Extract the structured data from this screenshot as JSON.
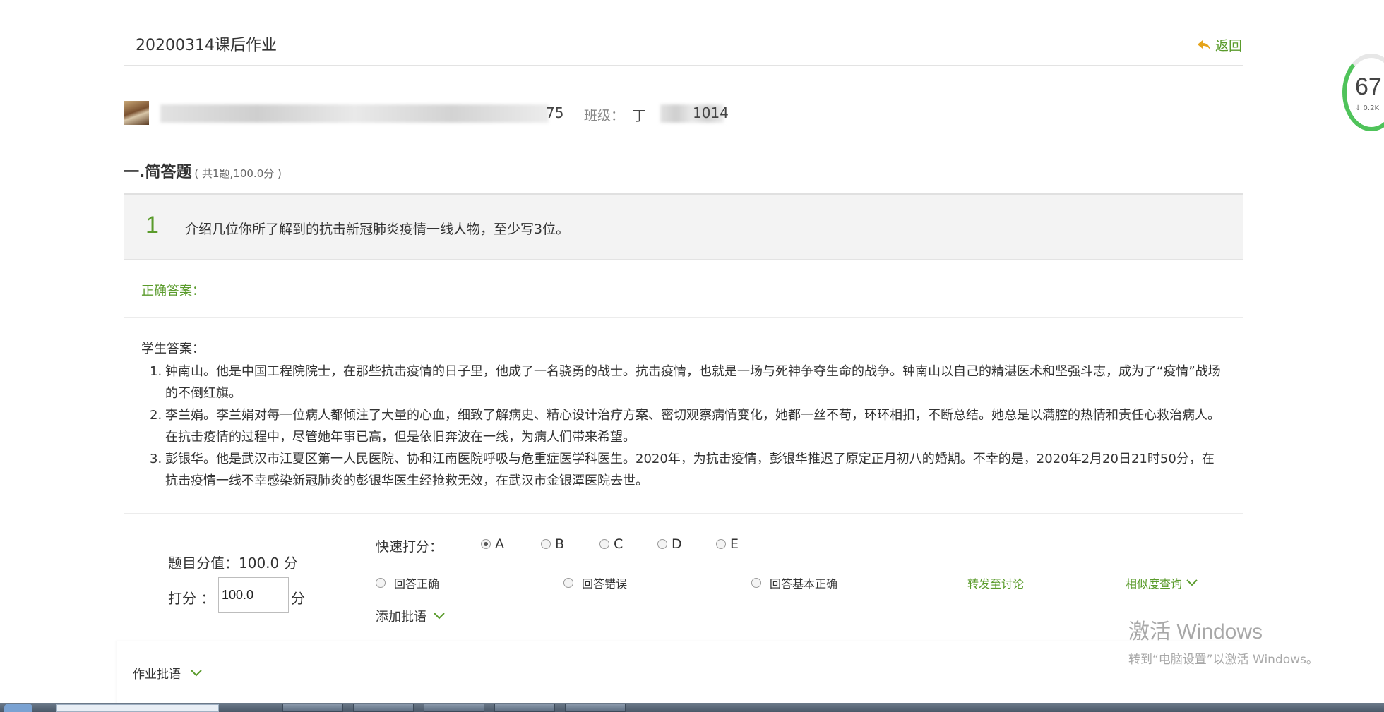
{
  "header": {
    "title": "20200314课后作业",
    "back_label": "返回"
  },
  "score_widget": {
    "value": "67",
    "sub": "↓ 0.2K"
  },
  "student": {
    "id_tail": "75",
    "class_label": "班级：",
    "class_prefix": "丁",
    "class_tail": "1014"
  },
  "section": {
    "name": "一.简答题",
    "meta": "( 共1题,100.0分 )"
  },
  "question": {
    "number": "1",
    "text": "介绍几位你所了解到的抗击新冠肺炎疫情一线人物，至少写3位。",
    "correct_label": "正确答案：",
    "student_answer_label": "学生答案：",
    "answers": [
      {
        "index": "1.",
        "text": "钟南山。他是中国工程院院士，在那些抗击疫情的日子里，他成了一名骁勇的战士。抗击疫情，也就是一场与死神争夺生命的战争。钟南山以自己的精湛医术和坚强斗志，成为了“疫情”战场的不倒红旗。"
      },
      {
        "index": "2.",
        "text": "李兰娟。李兰娟对每一位病人都倾注了大量的心血，细致了解病史、精心设计治疗方案、密切观察病情变化，她都一丝不苟，环环相扣，不断总结。她总是以满腔的热情和责任心救治病人。在抗击疫情的过程中，尽管她年事已高，但是依旧奔波在一线，为病人们带来希望。"
      },
      {
        "index": "3.",
        "text": "彭银华。他是武汉市江夏区第一人民医院、协和江南医院呼吸与危重症医学科医生。2020年，为抗击疫情，彭银华推迟了原定正月初八的婚期。不幸的是，2020年2月20日21时50分，在抗击疫情一线不幸感染新冠肺炎的彭银华医生经抢救无效，在武汉市金银潭医院去世。"
      }
    ]
  },
  "grading": {
    "total_label": "题目分值：100.0 分",
    "score_label": "打分 ：",
    "score_value": "100.0",
    "score_unit": "分",
    "quick_label": "快速打分：",
    "quick_options": [
      "A",
      "B",
      "C",
      "D",
      "E"
    ],
    "quick_selected": "A",
    "comment_options": [
      "回答正确",
      "回答错误",
      "回答基本正确"
    ],
    "forward_label": "转发至讨论",
    "similar_label": "相似度查询",
    "add_comment_label": "添加批语"
  },
  "homework_comment": {
    "label": "作业批语"
  },
  "watermark": {
    "title": "激活 Windows",
    "subtitle": "转到“电脑设置”以激活 Windows。"
  },
  "colors": {
    "accent_green": "#5a9b2b",
    "border_gray": "#e0e0e0",
    "question_bg": "#f3f3f3"
  }
}
